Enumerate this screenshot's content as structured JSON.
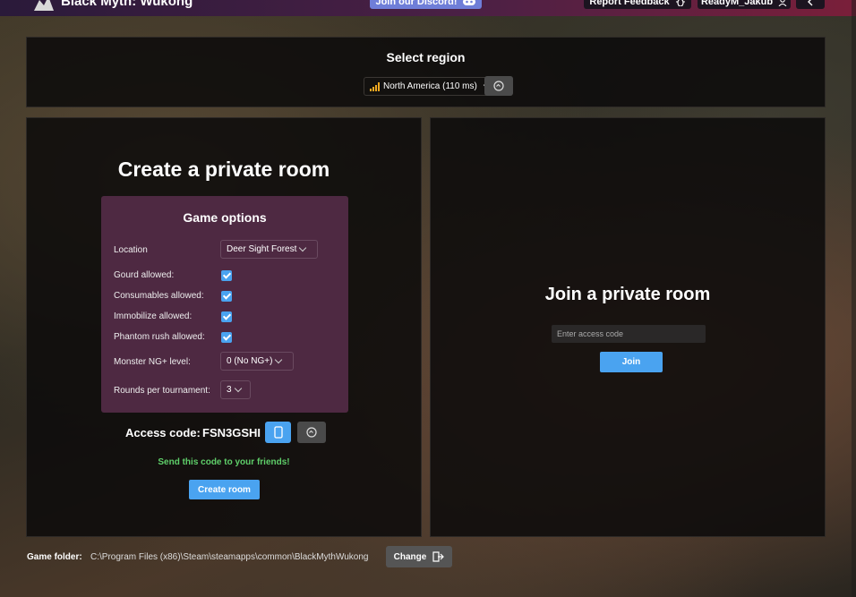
{
  "header": {
    "app_title": "Black Myth: Wukong",
    "discord_label": "Join our Discord!",
    "feedback_label": "Report Feedback",
    "username": "ReadyM_Jakub"
  },
  "region": {
    "title": "Select region",
    "selected": "North America (110 ms)"
  },
  "create_room": {
    "title": "Create a private room",
    "options": {
      "title": "Game options",
      "location_label": "Location",
      "location_value": "Deer Sight Forest",
      "gourd_label": "Gourd allowed:",
      "gourd_checked": true,
      "consumables_label": "Consumables allowed:",
      "consumables_checked": true,
      "immobilize_label": "Immobilize allowed:",
      "immobilize_checked": true,
      "phantom_rush_label": "Phantom rush allowed:",
      "phantom_rush_checked": true,
      "ng_label": "Monster NG+ level:",
      "ng_value": "0 (No NG+)",
      "rounds_label": "Rounds per tournament:",
      "rounds_value": "3"
    },
    "access_code_label": "Access code:",
    "access_code": "FSN3GSHI",
    "hint": "Send this code to your friends!",
    "create_button": "Create room"
  },
  "join_room": {
    "title": "Join a private room",
    "access_code_placeholder": "Enter access code",
    "join_button": "Join"
  },
  "footer": {
    "game_folder_label": "Game folder:",
    "game_folder_path": "C:\\Program Files (x86)\\Steam\\steamapps\\common\\BlackMythWukong",
    "change_button": "Change"
  },
  "colors": {
    "accent_blue": "#4aa3f0",
    "options_bg": "#4e2942",
    "hint_green": "#5fcf6a",
    "signal_orange": "#f0a820"
  }
}
